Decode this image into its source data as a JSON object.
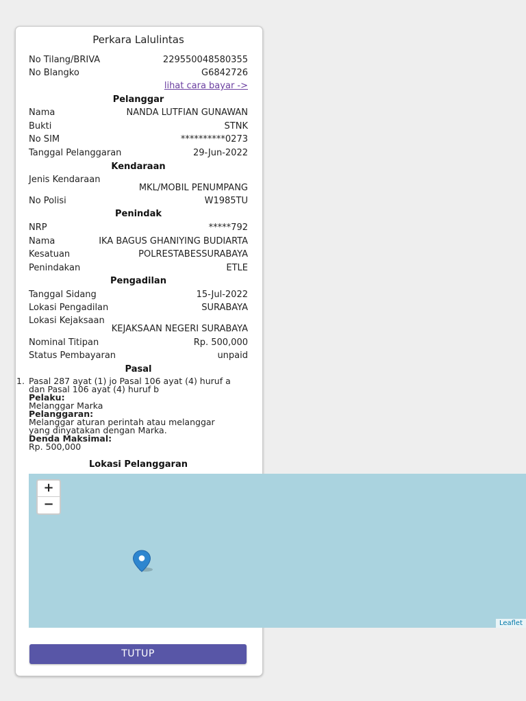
{
  "dialog": {
    "title": "Perkara Lalulintas",
    "no_tilang_label": "No Tilang/BRIVA",
    "no_tilang_value": "229550048580355",
    "no_blangko_label": "No Blangko",
    "no_blangko_value": "G6842726",
    "pay_link": "lihat cara bayar ->"
  },
  "pelanggar": {
    "heading": "Pelanggar",
    "nama_label": "Nama",
    "nama_value": "NANDA LUTFIAN GUNAWAN",
    "bukti_label": "Bukti",
    "bukti_value": "STNK",
    "sim_label": "No SIM",
    "sim_value": "**********0273",
    "tanggal_label": "Tanggal Pelanggaran",
    "tanggal_value": "29-Jun-2022"
  },
  "kendaraan": {
    "heading": "Kendaraan",
    "jenis_label": "Jenis Kendaraan",
    "jenis_value": "MKL/MOBIL PENUMPANG",
    "polisi_label": "No Polisi",
    "polisi_value": "W1985TU"
  },
  "penindak": {
    "heading": "Penindak",
    "nrp_label": "NRP",
    "nrp_value": "*****792",
    "nama_label": "Nama",
    "nama_value": "IKA BAGUS GHANIYING BUDIARTA",
    "kesatuan_label": "Kesatuan",
    "kesatuan_value": "POLRESTABESSURABAYA",
    "penindakan_label": "Penindakan",
    "penindakan_value": "ETLE"
  },
  "pengadilan": {
    "heading": "Pengadilan",
    "sidang_label": "Tanggal Sidang",
    "sidang_value": "15-Jul-2022",
    "lokasi_label": "Lokasi Pengadilan",
    "lokasi_value": "SURABAYA",
    "kejaksaan_label": "Lokasi Kejaksaan",
    "kejaksaan_value": "KEJAKSAAN NEGERI SURABAYA",
    "nominal_label": "Nominal Titipan",
    "nominal_value": "Rp. 500,000",
    "status_label": "Status Pembayaran",
    "status_value": "unpaid"
  },
  "pasal": {
    "heading": "Pasal",
    "number": "1.",
    "text": "Pasal 287 ayat (1) jo Pasal 106 ayat (4) huruf a dan Pasal 106 ayat (4) huruf b",
    "pelaku_label": "Pelaku:",
    "pelaku_value": "Melanggar Marka",
    "pelanggaran_label": "Pelanggaran:",
    "pelanggaran_value": "Melanggar aturan perintah atau melanggar yang dinyatakan dengan Marka.",
    "denda_label": "Denda Maksimal:",
    "denda_value": "Rp. 500,000"
  },
  "lokasi": {
    "heading": "Lokasi Pelanggaran",
    "zoom_in": "+",
    "zoom_out": "−",
    "attribution": "Leaflet",
    "marker_icon": "map-marker-icon",
    "water_color": "#aad3df"
  },
  "footer": {
    "close_label": "TUTUP",
    "accent_color": "#5856a7"
  }
}
